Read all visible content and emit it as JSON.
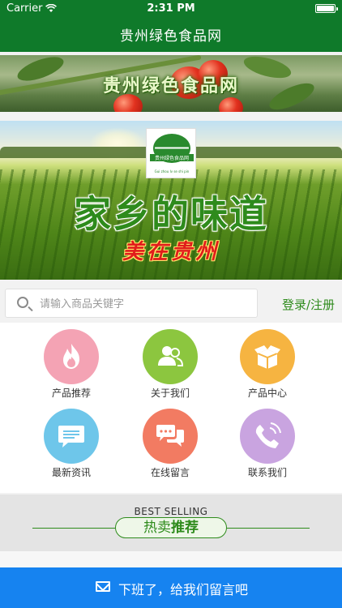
{
  "status": {
    "carrier": "Carrier",
    "time": "2:31 PM"
  },
  "nav": {
    "title": "贵州绿色食品网"
  },
  "banner_top": {
    "title": "贵州绿色食品网"
  },
  "banner_main": {
    "logo_name": "贵州绿色食品网",
    "logo_sub": "Gui zhou lv se shi pin",
    "slogan": "家乡的味道",
    "sub_slogan": "美在贵州"
  },
  "search": {
    "placeholder": "请输入商品关键字",
    "login_label": "登录/注册"
  },
  "grid": [
    {
      "label": "产品推荐",
      "color": "#f4a3b4",
      "icon": "flame-icon"
    },
    {
      "label": "关于我们",
      "color": "#8cc63f",
      "icon": "users-icon"
    },
    {
      "label": "产品中心",
      "color": "#f6b441",
      "icon": "box-icon"
    },
    {
      "label": "最新资讯",
      "color": "#6ec6ea",
      "icon": "message-icon"
    },
    {
      "label": "在线留言",
      "color": "#f27b62",
      "icon": "chat-icon"
    },
    {
      "label": "联系我们",
      "color": "#c9a4e0",
      "icon": "phone-icon"
    }
  ],
  "best": {
    "en": "BEST SELLING",
    "cn_a": "热卖",
    "cn_b": "推荐"
  },
  "bottom": {
    "label": "下班了，给我们留言吧"
  }
}
